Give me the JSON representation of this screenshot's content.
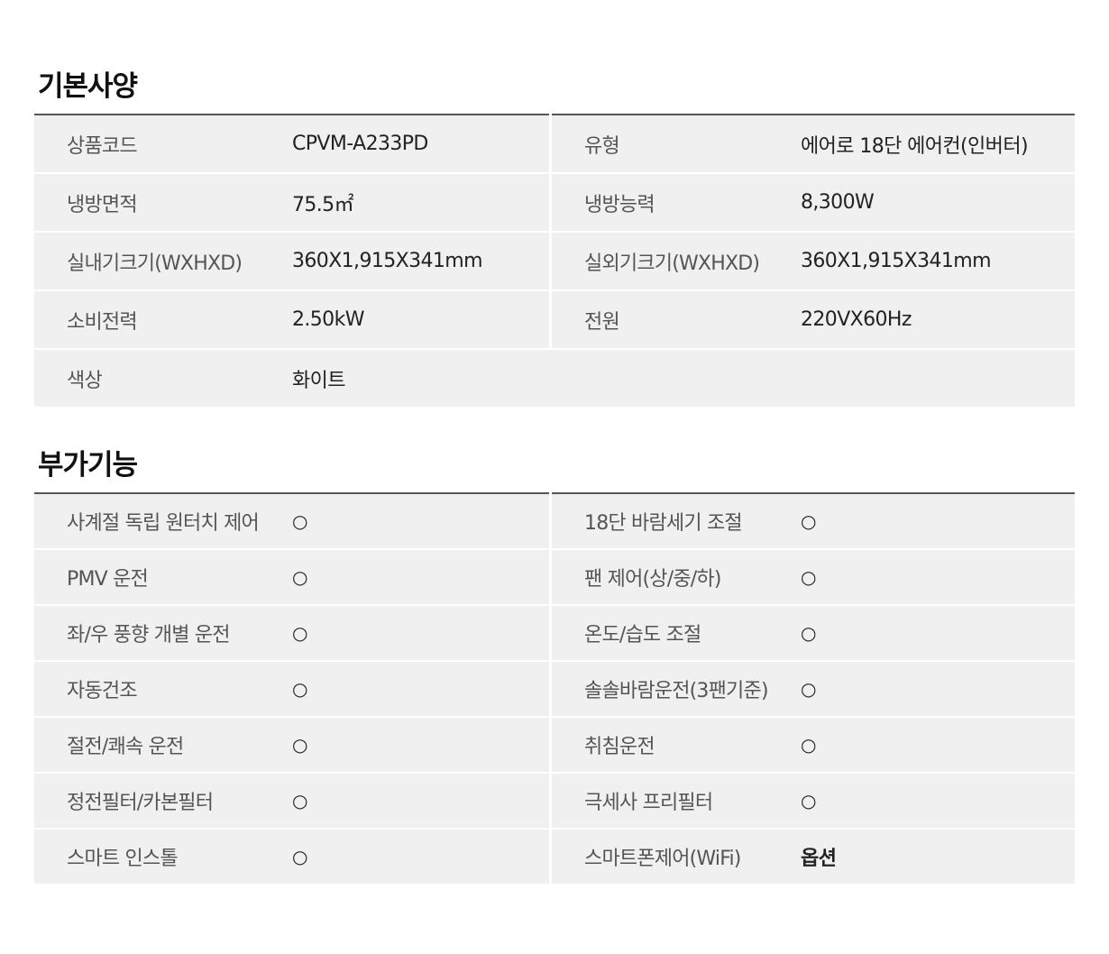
{
  "basic_spec": {
    "title": "기본사양",
    "rows": [
      {
        "left": {
          "label": "상품코드",
          "value": "CPVM-A233PD"
        },
        "right": {
          "label": "유형",
          "value": "에어로 18단 에어컨(인버터)"
        }
      },
      {
        "left": {
          "label": "냉방면적",
          "value": "75.5㎡"
        },
        "right": {
          "label": "냉방능력",
          "value": "8,300W"
        }
      },
      {
        "left": {
          "label": "실내기크기(WXHXD)",
          "value": "360X1,915X341mm"
        },
        "right": {
          "label": "실외기크기(WXHXD)",
          "value": "360X1,915X341mm"
        }
      },
      {
        "left": {
          "label": "소비전력",
          "value": "2.50kW"
        },
        "right": {
          "label": "전원",
          "value": "220VX60Hz"
        }
      },
      {
        "left": {
          "label": "색상",
          "value": "화이트"
        }
      }
    ]
  },
  "extra_features": {
    "title": "부가기능",
    "rows": [
      {
        "left": {
          "label": "사계절 독립 원터치 제어",
          "value": "○"
        },
        "right": {
          "label": "18단 바람세기 조절",
          "value": "○"
        }
      },
      {
        "left": {
          "label": "PMV 운전",
          "value": "○"
        },
        "right": {
          "label": "팬 제어(상/중/하)",
          "value": "○"
        }
      },
      {
        "left": {
          "label": "좌/우 풍향 개별 운전",
          "value": "○"
        },
        "right": {
          "label": "온도/습도 조절",
          "value": "○"
        }
      },
      {
        "left": {
          "label": "자동건조",
          "value": "○"
        },
        "right": {
          "label": "솔솔바람운전(3팬기준)",
          "value": "○"
        }
      },
      {
        "left": {
          "label": "절전/쾌속 운전",
          "value": "○"
        },
        "right": {
          "label": "취침운전",
          "value": "○"
        }
      },
      {
        "left": {
          "label": "정전필터/카본필터",
          "value": "○"
        },
        "right": {
          "label": "극세사 프리필터",
          "value": "○"
        }
      },
      {
        "left": {
          "label": "스마트 인스톨",
          "value": "○"
        },
        "right": {
          "label": "스마트폰제어(WiFi)",
          "value": "옵션"
        }
      }
    ]
  }
}
